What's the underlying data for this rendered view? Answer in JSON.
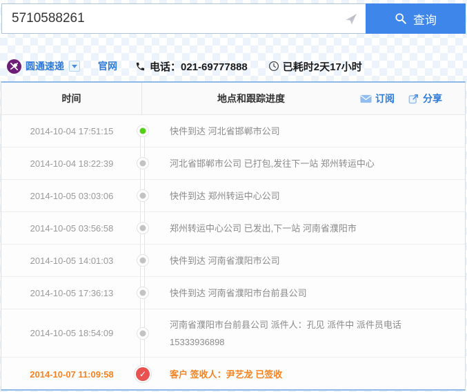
{
  "search": {
    "tracking_number": "5710588261",
    "query_button": "查询"
  },
  "carrier": {
    "name": "圆通速递",
    "official_site": "官网",
    "phone": "电话：021-69777888",
    "elapsed": "已耗时2天17小时"
  },
  "table": {
    "col_time": "时间",
    "col_progress": "地点和跟踪进度",
    "subscribe": "订阅",
    "share": "分享",
    "rows": [
      {
        "time": "2014-10-04 17:51:15",
        "text": "快件到达 河北省邯郸市公司"
      },
      {
        "time": "2014-10-04 18:22:39",
        "text": "河北省邯郸市公司 已打包,发往下一站 郑州转运中心"
      },
      {
        "time": "2014-10-05 03:03:06",
        "text": "快件到达 郑州转运中心公司"
      },
      {
        "time": "2014-10-05 03:56:58",
        "text": "郑州转运中心公司 已发出,下一站 河南省濮阳市"
      },
      {
        "time": "2014-10-05 14:01:03",
        "text": "快件到达 河南省濮阳市公司"
      },
      {
        "time": "2014-10-05 17:36:13",
        "text": "快件到达 河南省濮阳市台前县公司"
      },
      {
        "time": "2014-10-05 18:54:09",
        "text": "河南省濮阳市台前县公司 派件人：孔见 派件中 派件员电话 15333936898"
      },
      {
        "time": "2014-10-07 11:09:58",
        "text": "客户 签收人：尹艺龙 已签收"
      }
    ]
  },
  "icons": {
    "check": "✓",
    "send": "paper-plane",
    "search": "magnifier",
    "logo": "yto-emblem",
    "phone": "handset",
    "clock": "clock-face",
    "subscribe": "envelope",
    "share": "export-arrow"
  },
  "colors": {
    "button_blue": "#3e86e9",
    "link_blue": "#2d7ad8",
    "table_border_blue": "#8cb8e8",
    "start_green": "#53d013",
    "signed_orange": "#f6821f",
    "signed_red": "#e85352",
    "logo_purple": "#6d1e76"
  }
}
